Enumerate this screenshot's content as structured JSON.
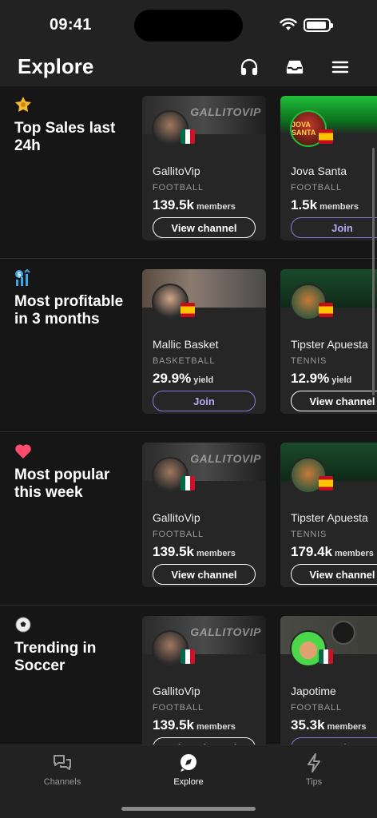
{
  "status": {
    "time": "09:41"
  },
  "header": {
    "title": "Explore"
  },
  "sections": [
    {
      "title": "Top Sales last 24h",
      "icon": "medal-icon",
      "cards": [
        {
          "name": "GallitoVip",
          "sport": "FOOTBALL",
          "metric": "139.5k",
          "unit": "members",
          "button": "View channel",
          "banner_text": "GALLITOVIP"
        },
        {
          "name": "Jova Santa",
          "sport": "FOOTBALL",
          "metric": "1.5k",
          "unit": "members",
          "button": "Join",
          "avatar_text": "JOVA SANTA"
        }
      ]
    },
    {
      "title": "Most profitable in 3 months",
      "icon": "chart-dollar-icon",
      "cards": [
        {
          "name": "Mallic Basket",
          "sport": "BASKETBALL",
          "metric": "29.9%",
          "unit": "yield",
          "button": "Join"
        },
        {
          "name": "Tipster Apuesta",
          "sport": "TENNIS",
          "metric": "12.9%",
          "unit": "yield",
          "button": "View channel"
        }
      ]
    },
    {
      "title": "Most popular this week",
      "icon": "heart-icon",
      "cards": [
        {
          "name": "GallitoVip",
          "sport": "FOOTBALL",
          "metric": "139.5k",
          "unit": "members",
          "button": "View channel",
          "banner_text": "GALLITOVIP"
        },
        {
          "name": "Tipster Apuesta",
          "sport": "TENNIS",
          "metric": "179.4k",
          "unit": "members",
          "button": "View channel"
        }
      ]
    },
    {
      "title": "Trending in Soccer",
      "icon": "soccer-ball-icon",
      "cards": [
        {
          "name": "GallitoVip",
          "sport": "FOOTBALL",
          "metric": "139.5k",
          "unit": "members",
          "button": "View channel",
          "banner_text": "GALLITOVIP"
        },
        {
          "name": "Japotime",
          "sport": "FOOTBALL",
          "metric": "35.3k",
          "unit": "members",
          "button": "Join"
        }
      ]
    }
  ],
  "bottom_nav": [
    {
      "label": "Channels",
      "icon": "chat-bubbles-icon",
      "active": false
    },
    {
      "label": "Explore",
      "icon": "compass-icon",
      "active": true
    },
    {
      "label": "Tips",
      "icon": "lightning-icon",
      "active": false
    }
  ],
  "colors": {
    "background": "#161616",
    "surface": "#262626",
    "accent": "#8a7ad8",
    "heart": "#ff4b6e"
  }
}
